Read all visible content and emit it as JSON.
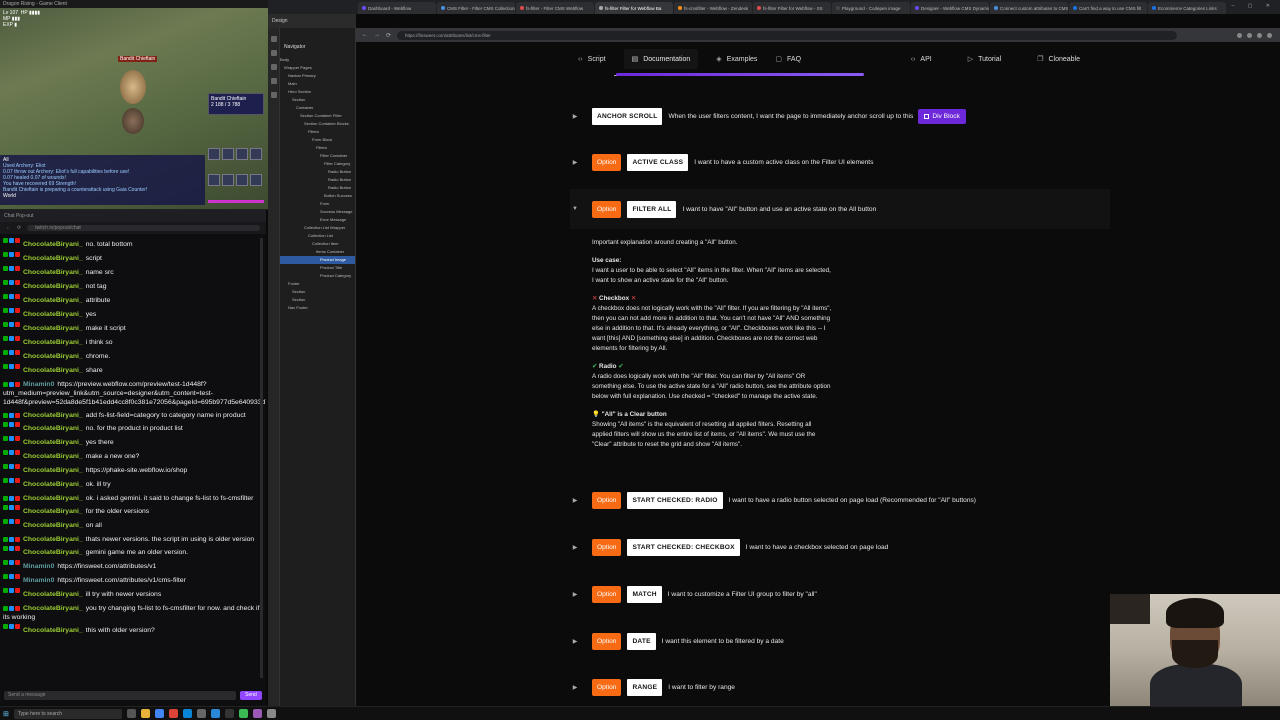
{
  "game": {
    "window_title": "Dragon Rising - Game Client",
    "boss_name": "Bandit Chieftain",
    "boss_card_title": "Bandit Chieftain",
    "boss_card_hp": "2 188 / 3 788",
    "chat_lines": [
      "Used Archery: Eliot",
      "0.07 throw out Archery: Eliot's full capabilities before use!",
      "0.07 healed 0.07 of wounds!",
      "You have recovered 69 Strength!",
      "Bandit Chieftain is preparing a counterattack using Gaia Counter!"
    ],
    "chat_tab": "All",
    "world_label": "World"
  },
  "chat": {
    "popout_title": "Chat Pop-out",
    "url": "twitch.tv/popout/chat",
    "input_placeholder": "Send a message",
    "send_label": "Send",
    "messages": [
      {
        "user": "ChocolateBiryani_",
        "text": "no. total bottom",
        "who": "cb"
      },
      {
        "user": "ChocolateBiryani_",
        "text": "script",
        "who": "cb"
      },
      {
        "user": "ChocolateBiryani_",
        "text": "name src",
        "who": "cb"
      },
      {
        "user": "ChocolateBiryani_",
        "text": "not tag",
        "who": "cb"
      },
      {
        "user": "ChocolateBiryani_",
        "text": "attribute",
        "who": "cb"
      },
      {
        "user": "ChocolateBiryani_",
        "text": "yes",
        "who": "cb"
      },
      {
        "user": "ChocolateBiryani_",
        "text": "make it script",
        "who": "cb"
      },
      {
        "user": "ChocolateBiryani_",
        "text": "i think so",
        "who": "cb"
      },
      {
        "user": "ChocolateBiryani_",
        "text": "chrome.",
        "who": "cb"
      },
      {
        "user": "ChocolateBiryani_",
        "text": "share",
        "who": "cb"
      },
      {
        "user": "Minamin0",
        "text": "https://preview.webflow.com/preview/test-1d448f?utm_medium=preview_link&utm_source=designer&utm_content=test-1d448f&preview=52da8de5f1b41edd4cc8f0c381e72056&pageId=695b977d5e640933d737bd29&locale=en&workflow=preview",
        "who": "mi",
        "wrap": true
      },
      {
        "user": "ChocolateBiryani_",
        "text": "add fs-list-field=category to category name in product",
        "who": "cb",
        "wrap": true
      },
      {
        "user": "ChocolateBiryani_",
        "text": "no. for the product in product list",
        "who": "cb"
      },
      {
        "user": "ChocolateBiryani_",
        "text": "yes there",
        "who": "cb"
      },
      {
        "user": "ChocolateBiryani_",
        "text": "make a new one?",
        "who": "cb"
      },
      {
        "user": "ChocolateBiryani_",
        "text": "https://phake-site.webflow.io/shop",
        "who": "cb"
      },
      {
        "user": "ChocolateBiryani_",
        "text": "ok. ill try",
        "who": "cb"
      },
      {
        "user": "ChocolateBiryani_",
        "text": "ok. i asked gemini. it said to change fs-list to fs-cmsfilter",
        "who": "cb",
        "wrap": true
      },
      {
        "user": "ChocolateBiryani_",
        "text": "for the older versions",
        "who": "cb"
      },
      {
        "user": "ChocolateBiryani_",
        "text": "on all",
        "who": "cb"
      },
      {
        "user": "ChocolateBiryani_",
        "text": "thats newer versions. the script im using is older version",
        "who": "cb",
        "wrap": true
      },
      {
        "user": "ChocolateBiryani_",
        "text": "gemini game me an older version.",
        "who": "cb"
      },
      {
        "user": "Minamin0",
        "text": "https://finsweet.com/attributes/v1",
        "who": "mi"
      },
      {
        "user": "Minamin0",
        "text": "https://finsweet.com/attributes/v1/cms-filter",
        "who": "mi"
      },
      {
        "user": "ChocolateBiryani_",
        "text": "ill try with newer versions",
        "who": "cb"
      },
      {
        "user": "ChocolateBiryani_",
        "text": "you try changing fs-list to fs-cmsfilter for now. and check if its working",
        "who": "cb",
        "wrap": true
      },
      {
        "user": "ChocolateBiryani_",
        "text": "this with older version?",
        "who": "cb"
      }
    ]
  },
  "taskbar": {
    "search_placeholder": "Type here to search"
  },
  "webflow": {
    "topbar_label": "Design",
    "navigator_title": "Navigator",
    "tree": [
      "Body",
      "Wrapper Pages",
      "Navbar Primary",
      "Main",
      "Hero Section",
      "Section",
      "Container",
      "Section Container Filter",
      "Section Container Blocks",
      "Filters",
      "Form Block",
      "Filters",
      "Filter Container",
      "Filter Category",
      "Radio Button",
      "Radio Button",
      "Radio Button",
      "Button Success",
      "Form",
      "Success Message",
      "Error Message",
      "Collection List Wrapper",
      "Collection List",
      "Collection Item",
      "Items Container",
      "Product Image",
      "Product Title",
      "Product Category",
      "Footer",
      "Section",
      "Section",
      "Nav Footer"
    ]
  },
  "browser": {
    "tabs": [
      {
        "label": "Dashboard - Webflow",
        "color": "#6d4aff"
      },
      {
        "label": "CMS Filter - Filter CMS Collections",
        "color": "#4a90e2"
      },
      {
        "label": "fs-filter - Filter CMS Webflow",
        "color": "#e24a4a"
      },
      {
        "label": "fs-filter Filter for Webflow Ba",
        "color": "#aaaaaa"
      },
      {
        "label": "fs-cmsfilter - Webflow - Zendesk",
        "color": "#ff8c1a"
      },
      {
        "label": "fs-filter Filter for Webflow - SS",
        "color": "#e24a4a"
      },
      {
        "label": "Playground - Codepen image",
        "color": "#444444"
      },
      {
        "label": "Designer - Webflow CMS Dynamic",
        "color": "#6d4aff"
      },
      {
        "label": "Connect custom attributes to CMS",
        "color": "#4a90e2"
      },
      {
        "label": "Can't find a way to use CMS filt",
        "color": "#1a73e8"
      },
      {
        "label": "Ecommerce Categories Links",
        "color": "#1a73e8"
      }
    ],
    "url": "https://finsweet.com/attributes/list/cms-filter",
    "back": "←",
    "forward": "→",
    "reload": "⟳"
  },
  "page": {
    "nav": {
      "script": "Script",
      "documentation": "Documentation",
      "examples": "Examples",
      "faq": "FAQ",
      "api": "API",
      "tutorial": "Tutorial",
      "cloneable": "Cloneable"
    },
    "rows": [
      {
        "id": "anchor",
        "key": "ANCHOR SCROLL",
        "desc": "When the user filters content, I want the page to immediately anchor scroll up to this",
        "option": "",
        "extra": "Div Block"
      },
      {
        "id": "active",
        "key": "ACTIVE CLASS",
        "desc": "I want to have a custom active class on the Filter UI elements",
        "option": "Option"
      },
      {
        "id": "filterall",
        "key": "FILTER ALL",
        "desc": "I want to have \"All\" button and use an active state on the All button",
        "option": "Option"
      },
      {
        "id": "radio",
        "key": "START CHECKED: RADIO",
        "desc": "I want to have a radio button selected on page load (Recommended for \"All\" buttons)",
        "option": "Option"
      },
      {
        "id": "checkbox",
        "key": "START CHECKED: CHECKBOX",
        "desc": "I want to have a checkbox selected on page load",
        "option": "Option"
      },
      {
        "id": "match",
        "key": "MATCH",
        "desc": "I want to customize a Filter UI group to filter by \"all\"",
        "option": "Option"
      },
      {
        "id": "date",
        "key": "DATE",
        "desc": "I want this element to be filtered by a date",
        "option": "Option"
      },
      {
        "id": "range",
        "key": "RANGE",
        "desc": "I want to filter by range",
        "option": "Option"
      }
    ],
    "filter_all": {
      "intro": "Important explanation around creating a \"All\" button.",
      "use_case_title": "Use case:",
      "use_case": "I want a user to be able to select \"All\" items in the filter. When \"All\" items are selected, I want to show an active state for the \"All\" button.",
      "checkbox_title": "Checkbox",
      "checkbox_text": "A checkbox does not logically work with the \"All\" filter. If you are filtering by \"All items\", then you can not add more in addition to that. You can't not have \"All\" AND something else in addition to that. It's already everything, or \"All\". Checkboxes work like this -- I want [this] AND [something else] in addition. Checkboxes are not the correct web elements for filtering by All.",
      "radio_title": "Radio",
      "radio_text": "A radio does logically work with the \"All\" filter. You can filter by \"All items\" OR something else. To use the active state for a \"All\" radio button, see the attribute option below with full explanation. Use checked = \"checked\" to manage the active state.",
      "clear_title": "\"All\" is a Clear button",
      "clear_text": "Showing \"All items\" is the equivalent of resetting all applied filters. Resetting all applied filters will show us the entire list of items, or \"All items\". We must use the \"Clear\" attribute to reset the grid and show \"All items\"."
    }
  }
}
